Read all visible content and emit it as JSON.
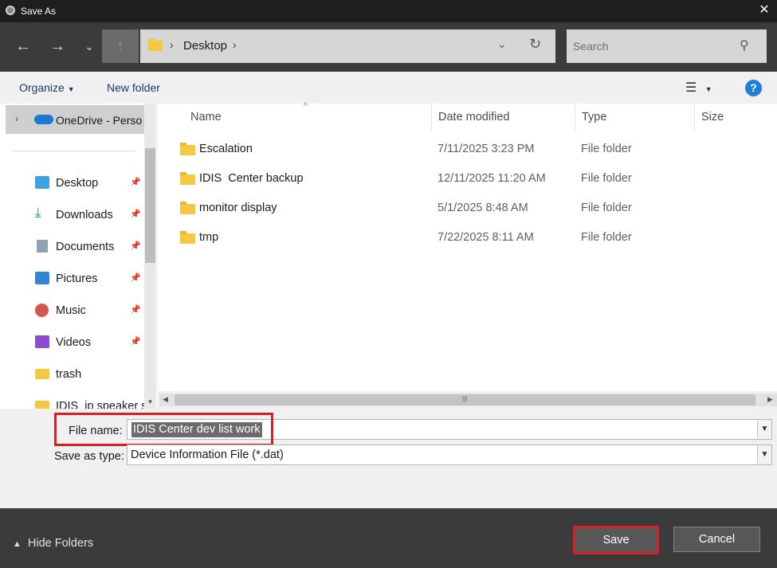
{
  "window": {
    "title": "Save As",
    "close_icon": "close-icon"
  },
  "nav": {
    "back_icon": "arrow-left-icon",
    "forward_icon": "arrow-right-icon",
    "recent_icon": "chevron-down-icon",
    "up_icon": "arrow-up-icon",
    "breadcrumb": [
      "Desktop"
    ],
    "search_placeholder": "Search"
  },
  "command_bar": {
    "organize": "Organize",
    "new_folder": "New folder",
    "help": "?"
  },
  "nav_pane": {
    "onedrive": "OneDrive - Perso",
    "quick_access": [
      {
        "label": "Desktop",
        "icon": "desktop-icon",
        "pinned": true
      },
      {
        "label": "Downloads",
        "icon": "download-icon",
        "pinned": true
      },
      {
        "label": "Documents",
        "icon": "documents-icon",
        "pinned": true
      },
      {
        "label": "Pictures",
        "icon": "pictures-icon",
        "pinned": true
      },
      {
        "label": "Music",
        "icon": "music-icon",
        "pinned": true
      },
      {
        "label": "Videos",
        "icon": "videos-icon",
        "pinned": true
      },
      {
        "label": "trash",
        "icon": "folder-icon",
        "pinned": false
      },
      {
        "label": "IDIS_ip speaker s",
        "icon": "folder-icon",
        "pinned": false
      }
    ]
  },
  "file_list": {
    "columns": [
      "Name",
      "Date modified",
      "Type",
      "Size"
    ],
    "rows": [
      {
        "name": "Escalation",
        "date": "7/11/2025 3:23 PM",
        "type": "File folder"
      },
      {
        "name": "IDIS  Center backup",
        "date": "12/11/2025 11:20 AM",
        "type": "File folder"
      },
      {
        "name": "monitor display",
        "date": "5/1/2025 8:48 AM",
        "type": "File folder"
      },
      {
        "name": "tmp",
        "date": "7/22/2025 8:11 AM",
        "type": "File folder"
      }
    ]
  },
  "form": {
    "file_name_label": "File name:",
    "file_name_value": "IDIS Center dev list work",
    "save_type_label": "Save as type:",
    "save_type_value": "Device Information File (*.dat)"
  },
  "footer": {
    "hide_folders": "Hide Folders",
    "save": "Save",
    "cancel": "Cancel"
  },
  "colors": {
    "highlight_red": "#d71f26",
    "help_blue": "#1e7fd4",
    "folder_yellow": "#f5c842"
  }
}
